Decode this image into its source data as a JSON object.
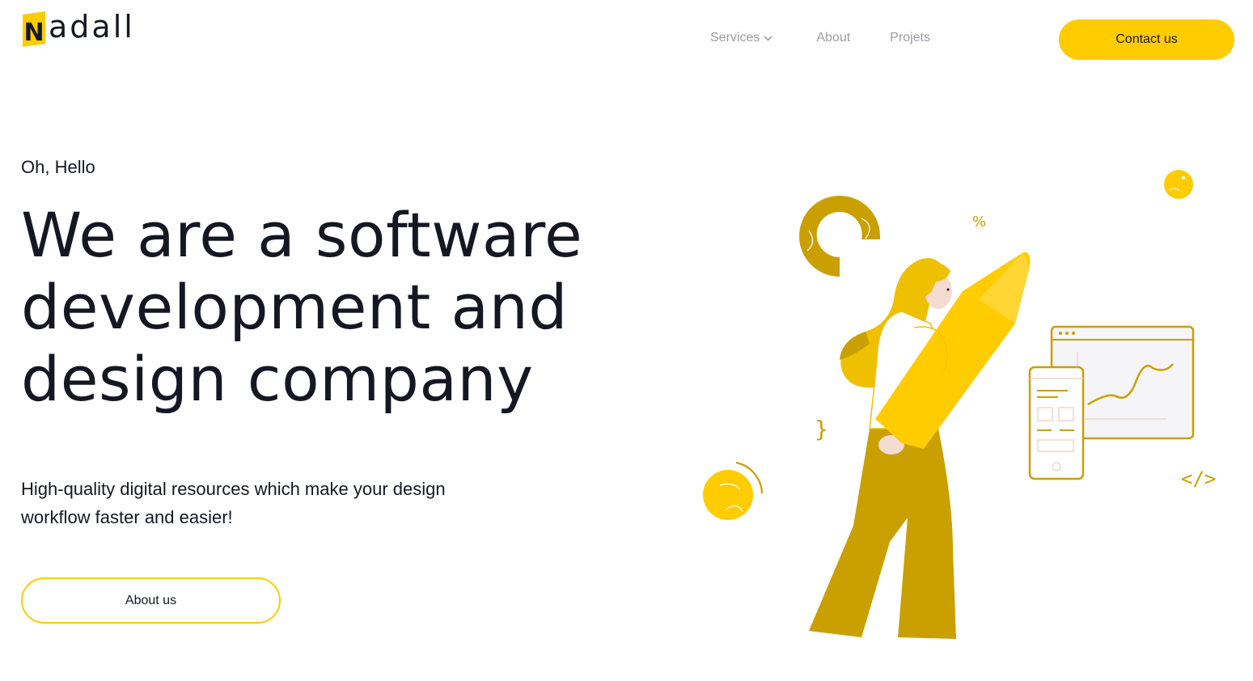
{
  "brand": {
    "name": "adall",
    "initial": "N",
    "accent": "#ffcc00",
    "accent_dark": "#c9a000"
  },
  "nav": {
    "services_label": "Services",
    "about_label": "About",
    "projects_label": "Projets",
    "contact_label": "Contact us"
  },
  "hero": {
    "greeting": "Oh, Hello",
    "headline": "We are a software development and design company",
    "subtitle": "High-quality digital resources which make your design workflow faster and easier!",
    "cta_label": "About us"
  },
  "illustration": {
    "percent_symbol": "%",
    "code_symbol": "</>",
    "brace_symbol": "}"
  },
  "icons": [
    "chevron-down-icon",
    "logo-mark-icon"
  ]
}
